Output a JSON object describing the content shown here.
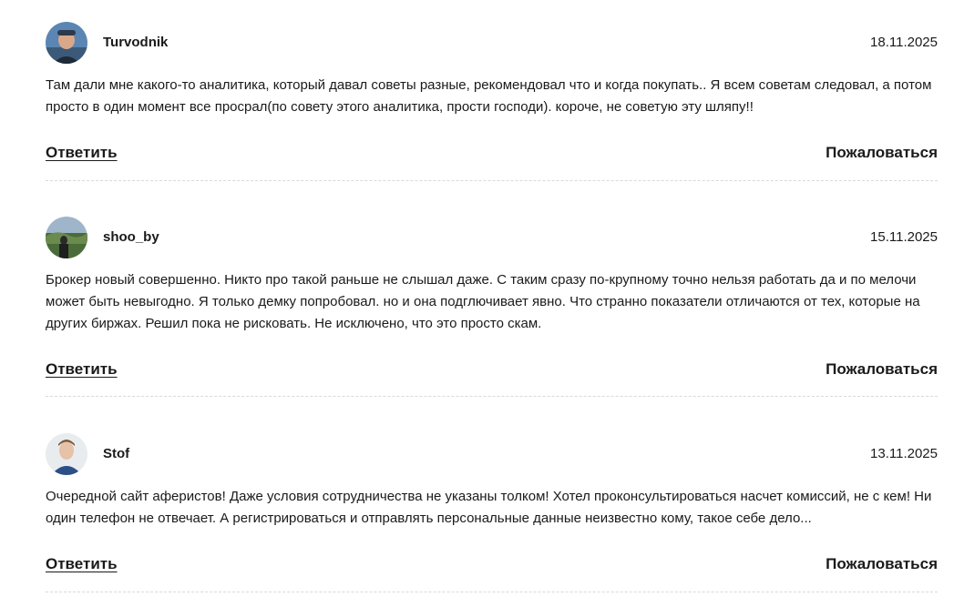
{
  "reviews": [
    {
      "author": "Turvodnik",
      "date": "18.11.2025",
      "text": "Там дали мне какого-то аналитика, который давал советы разные, рекомендовал что и когда покупать.. Я всем советам следовал, а потом просто в один момент все просрал(по совету этого аналитика, прости господи). короче, не советую эту шляпу!!",
      "reply_label": "Ответить",
      "complain_label": "Пожаловаться"
    },
    {
      "author": "shoo_by",
      "date": "15.11.2025",
      "text": "Брокер новый совершенно. Никто про такой раньше не слышал даже. С таким сразу по-крупному точно нельзя работать да и по мелочи может быть невыгодно. Я только демку попробовал. но и она подглючивает явно. Что странно показатели отличаются от тех, которые на других биржах. Решил пока не рисковать. Не исключено, что это просто скам.",
      "reply_label": "Ответить",
      "complain_label": "Пожаловаться"
    },
    {
      "author": "Stof",
      "date": "13.11.2025",
      "text": "Очередной сайт аферистов! Даже условия сотрудничества не указаны толком! Хотел проконсультироваться насчет комиссий, не с кем! Ни один телефон не отвечает. А регистрироваться и отправлять персональные данные неизвестно кому, такое себе дело...",
      "reply_label": "Ответить",
      "complain_label": "Пожаловаться"
    }
  ]
}
